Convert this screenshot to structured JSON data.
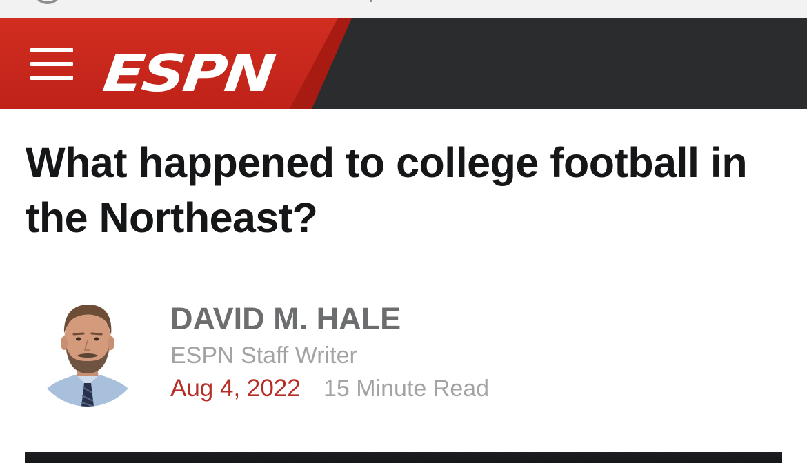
{
  "header": {
    "logo_text": "ESPN",
    "colors": {
      "brand_red": "#d22d21",
      "header_dark": "#2b2c2d"
    },
    "menu_icon": "hamburger-menu-icon"
  },
  "article": {
    "headline": "What happened to college football in the Northeast?",
    "author": {
      "name": "DAVID M. HALE",
      "role": "ESPN Staff Writer",
      "avatar_icon": "author-photo"
    },
    "date": "Aug 4, 2022",
    "read_time": "15 Minute Read",
    "colors": {
      "date": "#b72c24",
      "name": "#6c6d6f",
      "meta": "#a2a3a5"
    }
  }
}
